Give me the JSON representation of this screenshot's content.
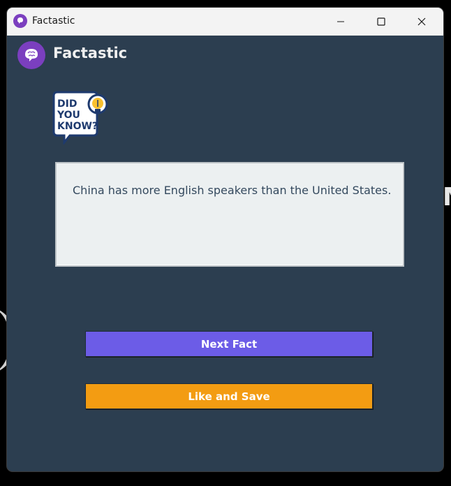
{
  "window": {
    "title": "Factastic",
    "controls": {
      "minimize": "minimize-icon",
      "maximize": "maximize-icon",
      "close": "close-icon"
    }
  },
  "header": {
    "app_name": "Factastic",
    "logo_icon": "brain-icon"
  },
  "badge": {
    "lines": [
      "DID",
      "YOU",
      "KNOW?"
    ],
    "icon": "lightbulb-icon"
  },
  "fact": {
    "text": "China has more English speakers than the United States."
  },
  "buttons": {
    "next_label": "Next Fact",
    "like_label": "Like and Save"
  },
  "colors": {
    "window_bg": "#2c3e50",
    "fact_bg": "#ecf0f1",
    "next_button": "#6c5ce7",
    "like_button": "#f39c12",
    "logo_circle": "#7b3fbf"
  }
}
